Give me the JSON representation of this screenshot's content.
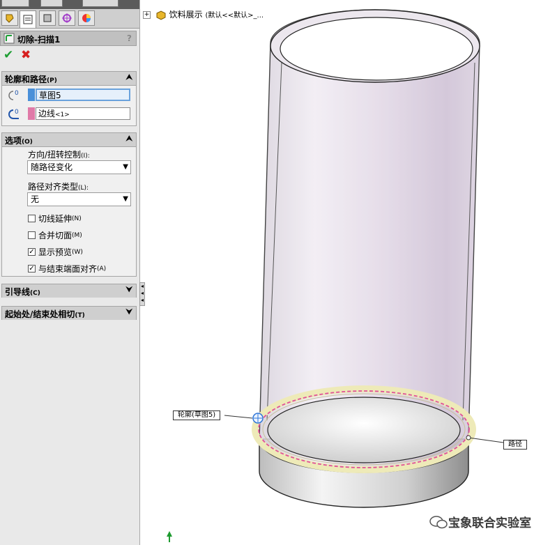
{
  "feature_manager": {
    "feature_title": "切除-扫描1",
    "help_glyph": "?",
    "ok_glyph": "✔",
    "cancel_glyph": "✖"
  },
  "profile_path": {
    "header": "轮廓和路径",
    "header_key": "(P)",
    "profile_value": "草图5",
    "path_value": "边线",
    "path_suffix": "<1>"
  },
  "options": {
    "header": "选项",
    "header_key": "(O)",
    "orientation_label": "方向/扭转控制",
    "orientation_key": "(I):",
    "orientation_value": "随路径变化",
    "path_align_label": "路径对齐类型",
    "path_align_key": "(L):",
    "path_align_value": "无",
    "checkboxes": [
      {
        "label": "切线延伸",
        "key": "(N)",
        "checked": false
      },
      {
        "label": "合并切面",
        "key": "(M)",
        "checked": false
      },
      {
        "label": "显示预览",
        "key": "(W)",
        "checked": true
      },
      {
        "label": "与结束端面对齐",
        "key": "(A)",
        "checked": true
      }
    ]
  },
  "guide_curves": {
    "header": "引导线",
    "header_key": "(C)"
  },
  "tangency": {
    "header": "起始处/结束处相切",
    "header_key": "(T)"
  },
  "tree": {
    "root": "饮料展示",
    "config": "(默认<<默认>_..."
  },
  "callouts": {
    "profile": "轮廓(草图5)",
    "path": "路径"
  },
  "watermark": "宝象联合实验室",
  "colors": {
    "profile_swatch": "#4a90d9",
    "path_swatch": "#e07aa8",
    "path_line": "#e0509a"
  }
}
